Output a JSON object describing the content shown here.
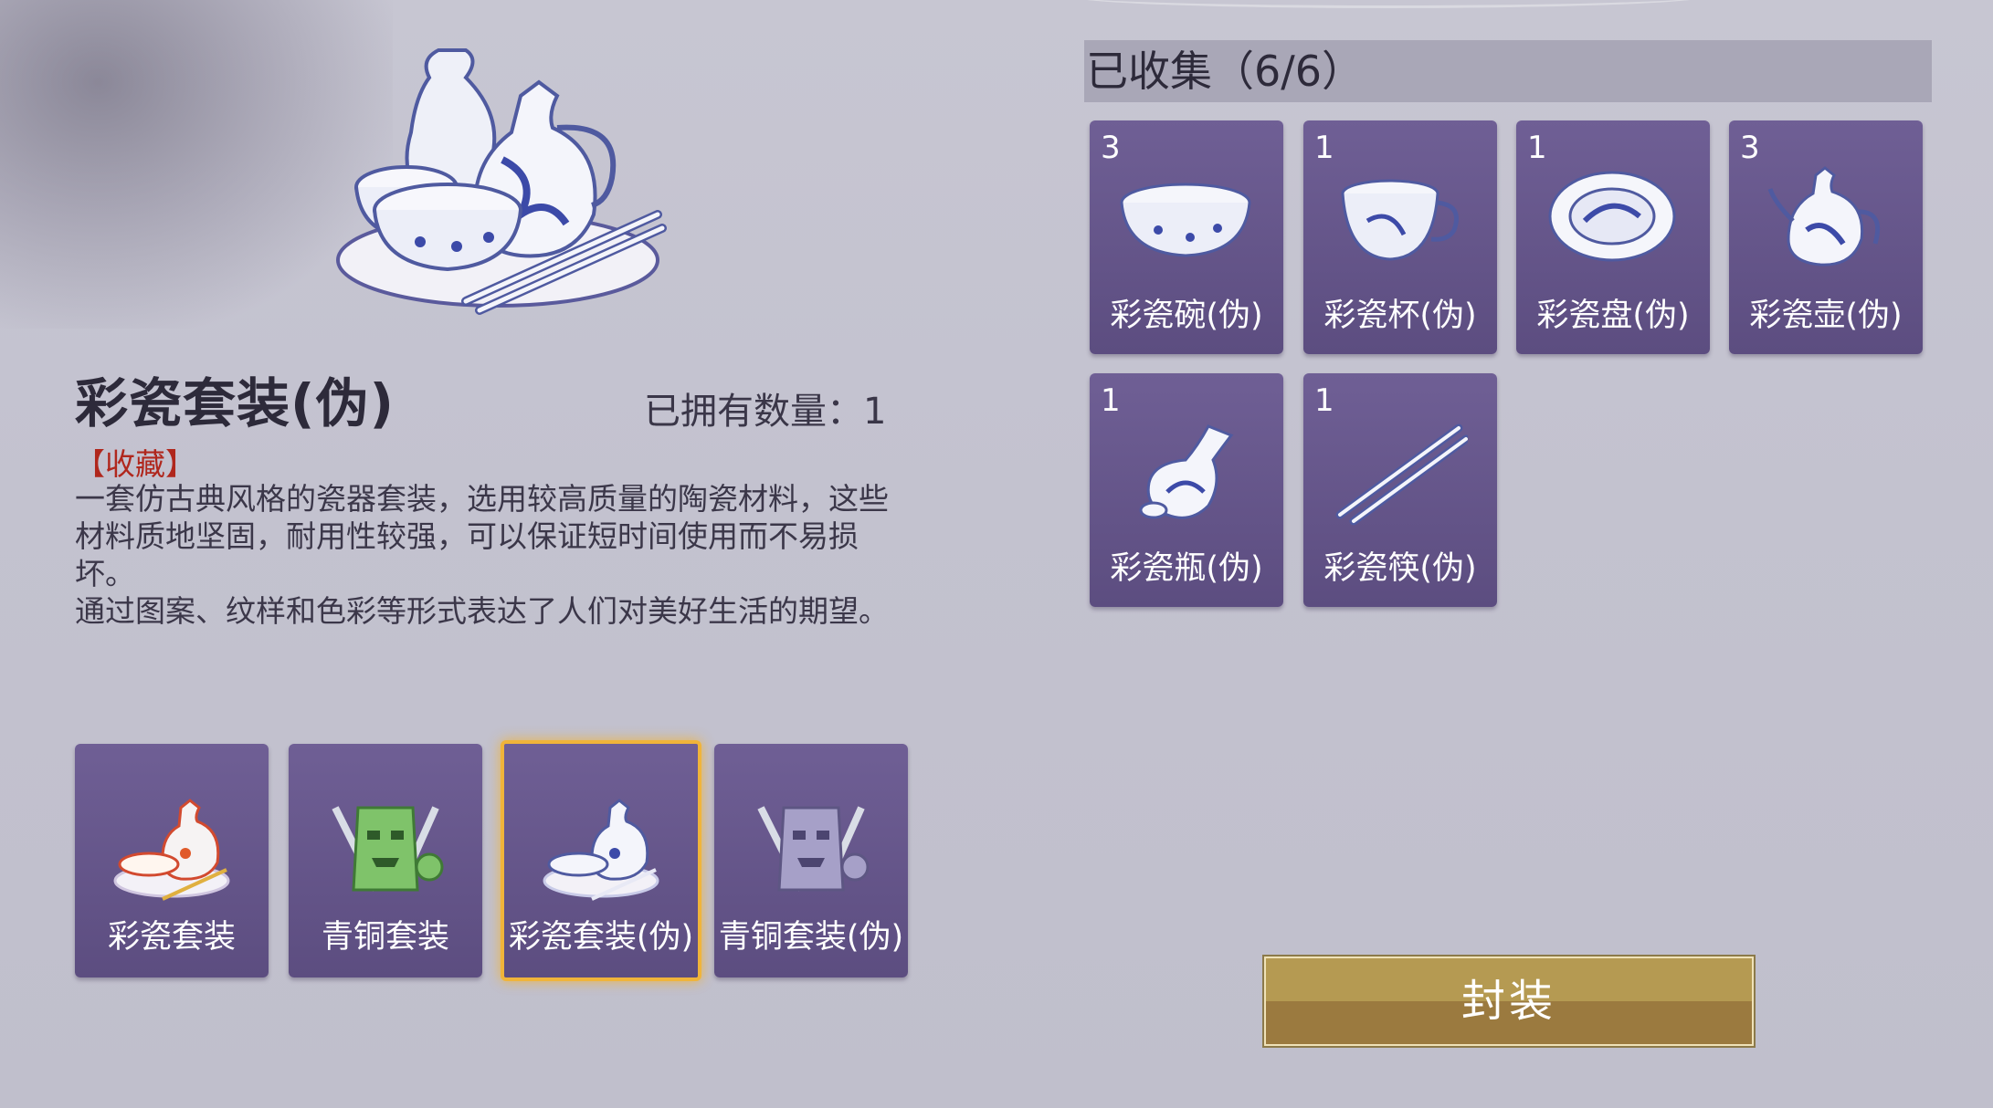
{
  "item": {
    "title": "彩瓷套装(伪)",
    "owned": "已拥有数量：1",
    "tag": "【收藏】",
    "desc1": "一套仿古典风格的瓷器套装，选用较高质量的陶瓷材料，这些材料质地坚固，耐用性较强，可以保证短时间使用而不易损坏。",
    "desc2": "通过图案、纹样和色彩等形式表达了人们对美好生活的期望。"
  },
  "sets": [
    {
      "label": "彩瓷套装",
      "icon": "porcelain-set-icon",
      "selected": false
    },
    {
      "label": "青铜套装",
      "icon": "bronze-set-icon",
      "selected": false
    },
    {
      "label": "彩瓷套装(伪)",
      "icon": "porcelain-set-icon",
      "selected": true
    },
    {
      "label": "青铜套装(伪)",
      "icon": "bronze-set-icon",
      "selected": false
    }
  ],
  "collection": {
    "header": "已收集（6/6）",
    "pieces": [
      {
        "count": "3",
        "label": "彩瓷碗(伪)",
        "icon": "bowl-icon"
      },
      {
        "count": "1",
        "label": "彩瓷杯(伪)",
        "icon": "cup-icon"
      },
      {
        "count": "1",
        "label": "彩瓷盘(伪)",
        "icon": "plate-icon"
      },
      {
        "count": "3",
        "label": "彩瓷壶(伪)",
        "icon": "ewer-icon"
      },
      {
        "count": "1",
        "label": "彩瓷瓶(伪)",
        "icon": "vase-icon"
      },
      {
        "count": "1",
        "label": "彩瓷筷(伪)",
        "icon": "chopsticks-icon"
      }
    ]
  },
  "actions": {
    "seal": "封装"
  },
  "colors": {
    "accent": "#f0b43a",
    "tag": "#b0271d",
    "tile": "#665789",
    "button": "#a9894a"
  }
}
